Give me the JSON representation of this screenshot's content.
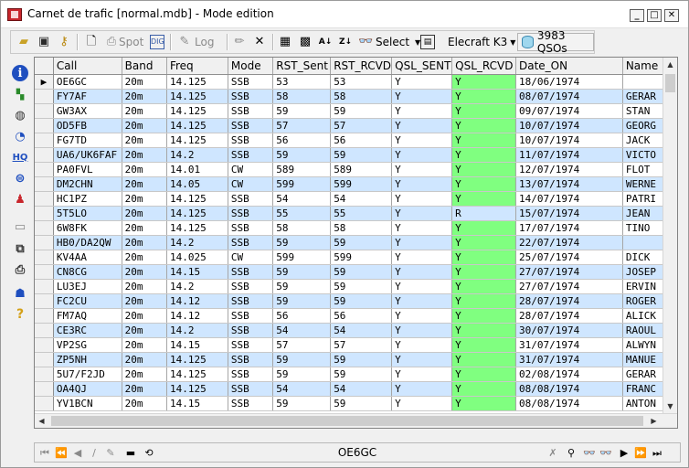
{
  "window": {
    "title": "Carnet de trafic [normal.mdb] - Mode edition"
  },
  "toolbar": {
    "spot_label": "Spot",
    "log_label": "Log",
    "select_label": "Select",
    "rig_label": "Elecraft K3",
    "qso_count": "3983 QSOs"
  },
  "grid": {
    "columns": [
      "Call",
      "Band",
      "Freq",
      "Mode",
      "RST_Sent",
      "RST_RCVD",
      "QSL_SENT",
      "QSL_RCVD",
      "Date_ON",
      "Name"
    ],
    "rows": [
      [
        "OE6GC",
        "20m",
        "14.125",
        "SSB",
        "53",
        "53",
        "Y",
        "Y",
        "18/06/1974",
        ""
      ],
      [
        "FY7AF",
        "20m",
        "14.125",
        "SSB",
        "58",
        "58",
        "Y",
        "Y",
        "08/07/1974",
        "GERAR"
      ],
      [
        "GW3AX",
        "20m",
        "14.125",
        "SSB",
        "59",
        "59",
        "Y",
        "Y",
        "09/07/1974",
        "STAN"
      ],
      [
        "OD5FB",
        "20m",
        "14.125",
        "SSB",
        "57",
        "57",
        "Y",
        "Y",
        "10/07/1974",
        "GEORG"
      ],
      [
        "FG7TD",
        "20m",
        "14.125",
        "SSB",
        "56",
        "56",
        "Y",
        "Y",
        "10/07/1974",
        "JACK"
      ],
      [
        "UA6/UK6FAF",
        "20m",
        "14.2",
        "SSB",
        "59",
        "59",
        "Y",
        "Y",
        "11/07/1974",
        "VICTO"
      ],
      [
        "PA0FVL",
        "20m",
        "14.01",
        "CW",
        "589",
        "589",
        "Y",
        "Y",
        "12/07/1974",
        "FLOT"
      ],
      [
        "DM2CHN",
        "20m",
        "14.05",
        "CW",
        "599",
        "599",
        "Y",
        "Y",
        "13/07/1974",
        "WERNE"
      ],
      [
        "HC1PZ",
        "20m",
        "14.125",
        "SSB",
        "54",
        "54",
        "Y",
        "Y",
        "14/07/1974",
        "PATRI"
      ],
      [
        "5T5LO",
        "20m",
        "14.125",
        "SSB",
        "55",
        "55",
        "Y",
        "R",
        "15/07/1974",
        "JEAN"
      ],
      [
        "6W8FK",
        "20m",
        "14.125",
        "SSB",
        "58",
        "58",
        "Y",
        "Y",
        "17/07/1974",
        "TINO"
      ],
      [
        "HB0/DA2QW",
        "20m",
        "14.2",
        "SSB",
        "59",
        "59",
        "Y",
        "Y",
        "22/07/1974",
        ""
      ],
      [
        "KV4AA",
        "20m",
        "14.025",
        "CW",
        "599",
        "599",
        "Y",
        "Y",
        "25/07/1974",
        "DICK"
      ],
      [
        "CN8CG",
        "20m",
        "14.15",
        "SSB",
        "59",
        "59",
        "Y",
        "Y",
        "27/07/1974",
        "JOSEP"
      ],
      [
        "LU3EJ",
        "20m",
        "14.2",
        "SSB",
        "59",
        "59",
        "Y",
        "Y",
        "27/07/1974",
        "ERVIN"
      ],
      [
        "FC2CU",
        "20m",
        "14.12",
        "SSB",
        "59",
        "59",
        "Y",
        "Y",
        "28/07/1974",
        "ROGER"
      ],
      [
        "FM7AQ",
        "20m",
        "14.12",
        "SSB",
        "56",
        "56",
        "Y",
        "Y",
        "28/07/1974",
        "ALICK"
      ],
      [
        "CE3RC",
        "20m",
        "14.2",
        "SSB",
        "54",
        "54",
        "Y",
        "Y",
        "30/07/1974",
        "RAOUL"
      ],
      [
        "VP2SG",
        "20m",
        "14.15",
        "SSB",
        "57",
        "57",
        "Y",
        "Y",
        "31/07/1974",
        "ALWYN"
      ],
      [
        "ZP5NH",
        "20m",
        "14.125",
        "SSB",
        "59",
        "59",
        "Y",
        "Y",
        "31/07/1974",
        "MANUE"
      ],
      [
        "5U7/F2JD",
        "20m",
        "14.125",
        "SSB",
        "59",
        "59",
        "Y",
        "Y",
        "02/08/1974",
        "GERAR"
      ],
      [
        "OA4QJ",
        "20m",
        "14.125",
        "SSB",
        "54",
        "54",
        "Y",
        "Y",
        "08/08/1974",
        "FRANC"
      ],
      [
        "YV1BCN",
        "20m",
        "14.15",
        "SSB",
        "59",
        "59",
        "Y",
        "Y",
        "08/08/1974",
        "ANTON"
      ]
    ]
  },
  "navigator": {
    "current_call": "OE6GC"
  },
  "colors": {
    "alt_row": "#cfe6ff",
    "qsl_rcvd": "#80ff80"
  }
}
